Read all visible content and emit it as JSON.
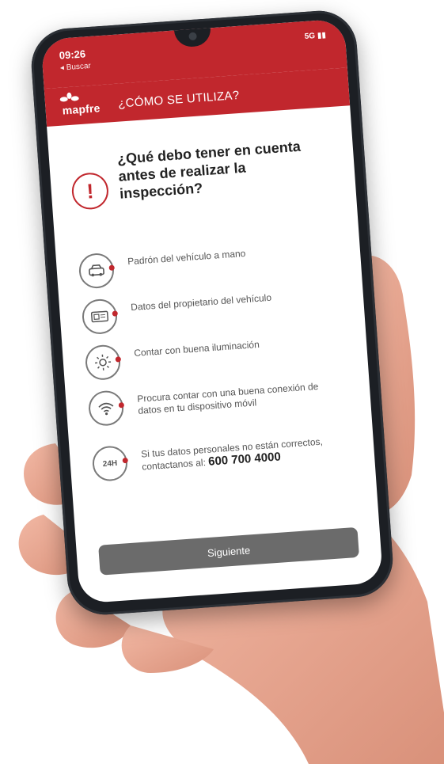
{
  "status": {
    "time": "09:26",
    "back": "◂ Buscar",
    "signal": "5G"
  },
  "app": {
    "brand": "mapfre",
    "title": "¿CÓMO SE UTILIZA?",
    "accent": "#c1272d"
  },
  "content": {
    "question": "¿Qué debo tener en cuenta antes de realizar la inspección?",
    "items": [
      {
        "icon": "car-icon",
        "label": "Padrón del vehículo a mano"
      },
      {
        "icon": "id-card-icon",
        "label": "Datos del propietario del vehículo"
      },
      {
        "icon": "sun-icon",
        "label": "Contar con buena iluminación"
      },
      {
        "icon": "wifi-icon",
        "label": "Procura contar con una buena conexión de datos en tu dispositivo móvil"
      },
      {
        "icon": "24h-icon",
        "label": "Si tus datos personales no están correctos, contactanos al:",
        "phone": "600 700 4000"
      }
    ]
  },
  "footer": {
    "next_label": "Siguiente"
  }
}
